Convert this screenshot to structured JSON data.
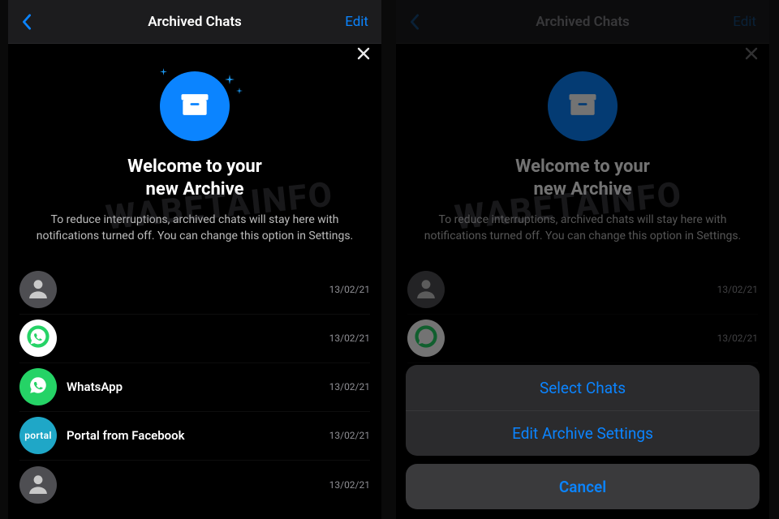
{
  "watermark": "WABETAINFO",
  "hero": {
    "title_line1": "Welcome to your",
    "title_line2": "new Archive",
    "desc": "To reduce interruptions, archived chats will stay here with notifications turned off. You can change this option in Settings."
  },
  "topbar": {
    "title": "Archived Chats",
    "edit_label": "Edit"
  },
  "chats": {
    "0": {
      "name": "",
      "date": "13/02/21"
    },
    "1": {
      "name": "",
      "date": "13/02/21"
    },
    "2": {
      "name": "WhatsApp",
      "date": "13/02/21"
    },
    "3": {
      "name": "Portal from Facebook",
      "date": "13/02/21"
    },
    "4": {
      "name": "",
      "date": "13/02/21"
    }
  },
  "sheet": {
    "option1": "Select Chats",
    "option2": "Edit Archive Settings",
    "cancel": "Cancel"
  },
  "icons": {
    "archive": "archive-box-icon",
    "person": "person-silhouette-icon",
    "whatsapp": "whatsapp-logo-icon",
    "portal": "portal-logo-icon"
  },
  "colors": {
    "accent": "#0b84ff",
    "whatsapp_green": "#25d366",
    "portal_teal": "#1fa7c7"
  }
}
